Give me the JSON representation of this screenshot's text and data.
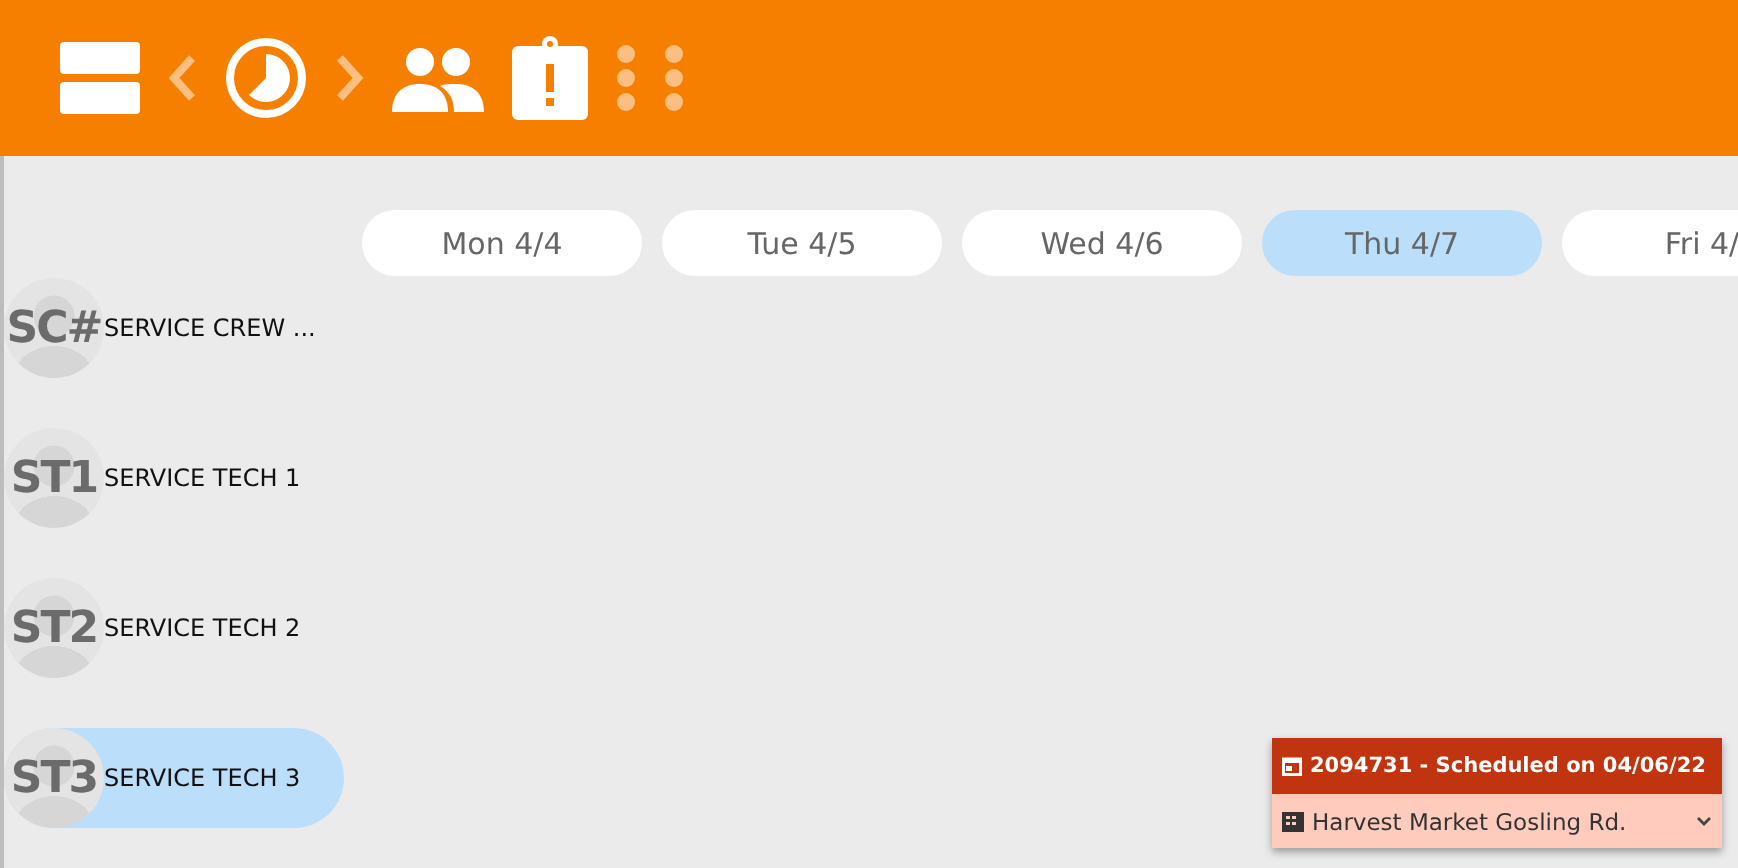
{
  "days": [
    {
      "label": "Mon 4/4",
      "selected": false
    },
    {
      "label": "Tue 4/5",
      "selected": false
    },
    {
      "label": "Wed 4/6",
      "selected": false
    },
    {
      "label": "Thu 4/7",
      "selected": true
    },
    {
      "label": "Fri 4/",
      "selected": false
    }
  ],
  "crews": [
    {
      "initials": "SC#",
      "name": "SERVICE CREW ...",
      "selected": false
    },
    {
      "initials": "ST1",
      "name": "SERVICE TECH 1",
      "selected": false
    },
    {
      "initials": "ST2",
      "name": "SERVICE TECH 2",
      "selected": false
    },
    {
      "initials": "ST3",
      "name": "SERVICE TECH 3",
      "selected": true
    }
  ],
  "job_card": {
    "title": "2094731 - Scheduled on 04/06/22",
    "location": "Harvest Market Gosling Rd."
  }
}
